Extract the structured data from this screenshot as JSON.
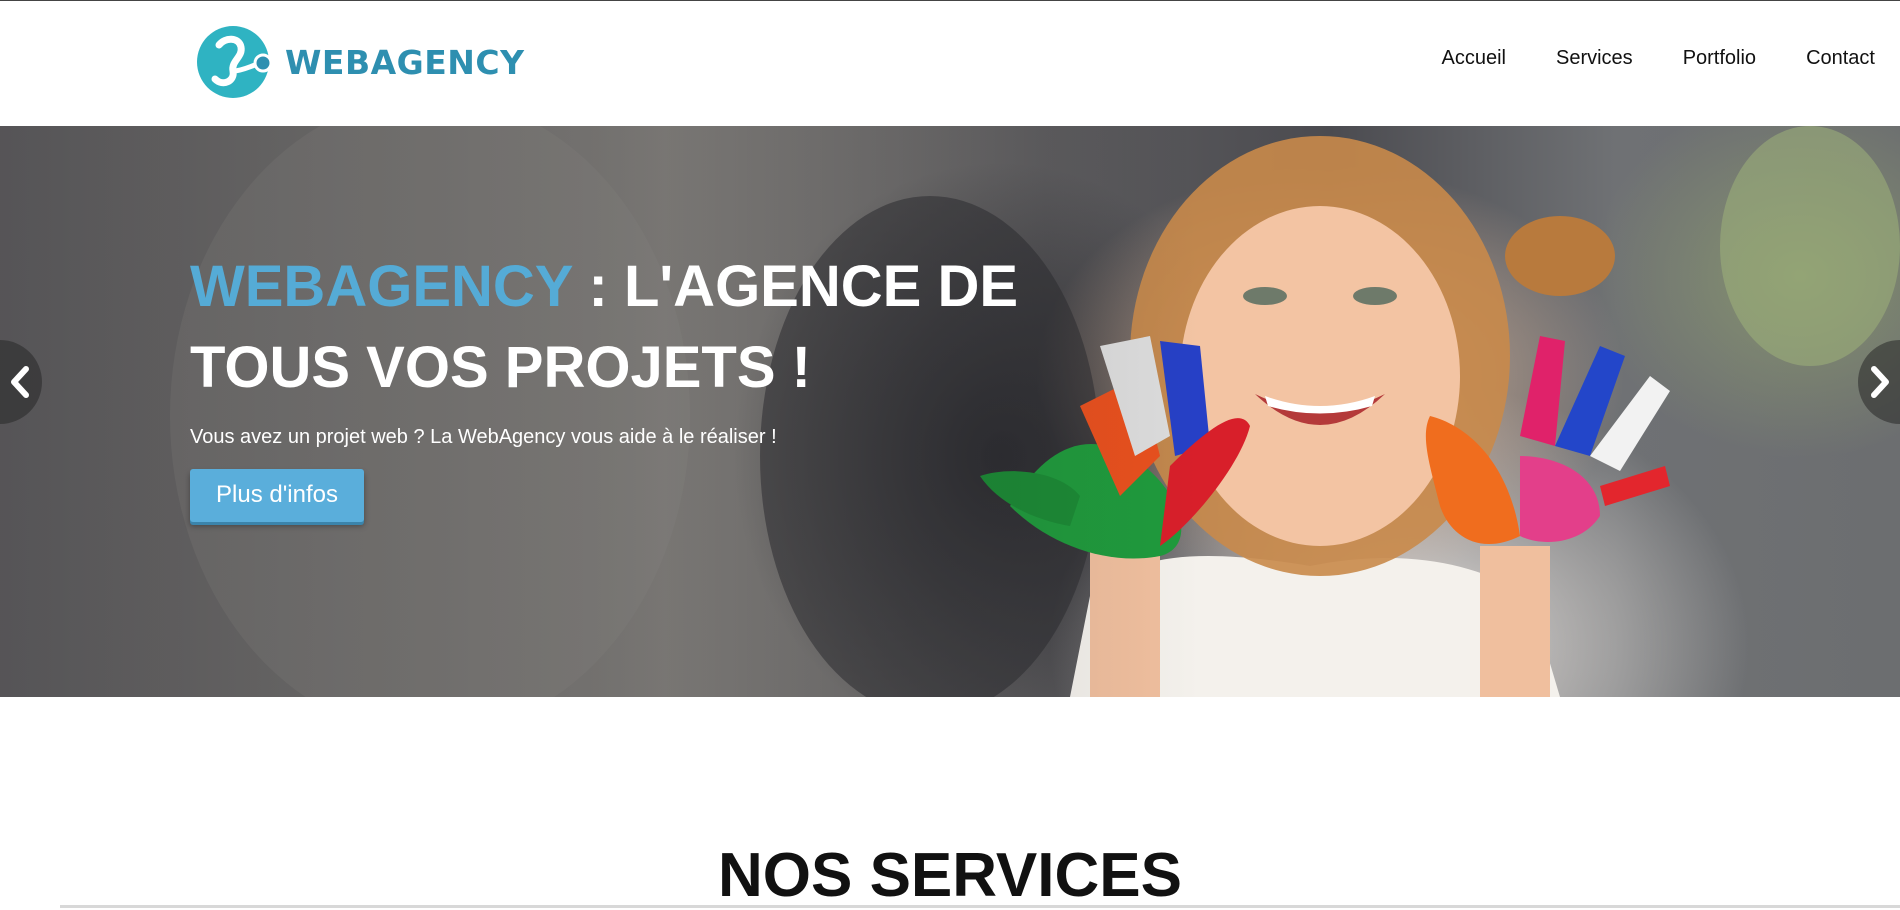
{
  "header": {
    "logo_text": "WEBAGENCY",
    "logo_icon": "webagency-logo-icon",
    "brand_color": "#2e8fb0",
    "nav": [
      {
        "label": "Accueil"
      },
      {
        "label": "Services"
      },
      {
        "label": "Portfolio"
      },
      {
        "label": "Contact"
      }
    ]
  },
  "hero": {
    "title_brand": "WEBAGENCY",
    "title_rest": " : L'AGENCE DE TOUS VOS PROJETS !",
    "subtitle": "Vous avez un projet web ? La WebAgency vous aide à le réaliser !",
    "button_label": "Plus d'infos",
    "accent_color": "#55abd6",
    "prev_icon": "chevron-left-icon",
    "next_icon": "chevron-right-icon"
  },
  "services": {
    "title": "NOS SERVICES"
  }
}
